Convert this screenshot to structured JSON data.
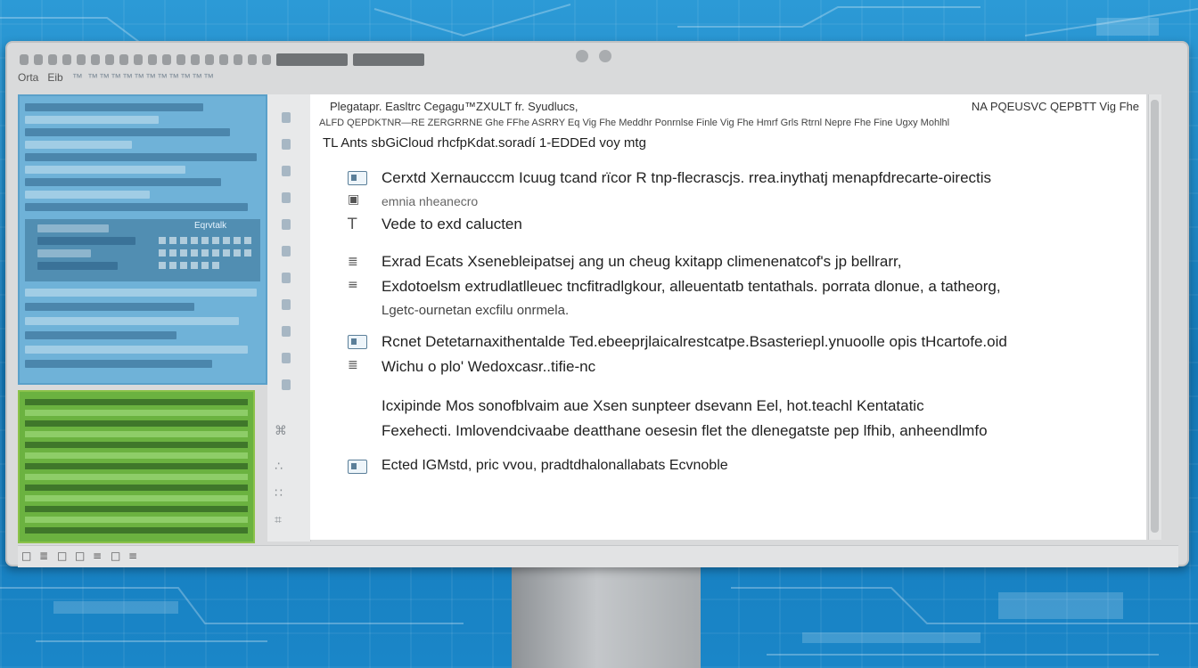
{
  "menubar": {
    "left": "Orta",
    "items": [
      "Eib",
      "™ ™™™™™™™™™™™"
    ]
  },
  "sidebar": {
    "panel_label": "Eqrvtalk"
  },
  "document": {
    "header_left": "Plegatapr. Easltrc Cegagu™ZXULT fr. Syudlucs,",
    "header_right": "NA PQEUSVC QEPBTT Vig Fhe",
    "header_line2": "ALFD QEPDKTNR—RE ZERGRRNE Ghe FFhe ASRRY Eq Vig Fhe Meddhr Ponrnlse Finle Vig Fhe Hmrf Grls Rtrnl Nepre Fhe Fine Ugxy Mohlhl",
    "header_line3": "TL Ants sbGiCloud rhcfpKdat.soradí 1-EDDEd voy mtg",
    "items": [
      "Cerxtd Xernaucccm   Icuug tcand rïcor R tnp-flecrascjs. rrea.inythatj menapfdrecarte-oirectis",
      "emnia nheanecro",
      "Vede to exd calucten",
      "Exrad Ecats Xsenebleipatsej ang un cheug kxitapp climenenatcof's jp bellrarr,",
      "Exdotoelsm extrudlatlleuec tncfitradlgkour, alleuentatb tentathals. porrata dlonue, a tatheorg,",
      "Lgetc-ournetan excfilu onrmela.",
      "Rcnet Detetarnaxithentalde Ted.ebeeprjlaicalrestcatpe.Bsasteriepl.ynuoolle opis tHcartofe.oid",
      "Wichu o plo' Wedoxcasr..tifie-nc",
      "Icxipinde Mos sonofblvaim aue Xsen sunpteer dsevann Eel, hot.teachl Kentatatic",
      "Fexehecti. Imlovendcivaabe deatthane oesesin flet the dlenegatste pep lfhib, anheendlmfo",
      "Ected IGMstd, pric vvou, pradtdhalonallabats Ecvnoble"
    ]
  },
  "status": {
    "items": [
      "□",
      "≣",
      "□",
      "□",
      "≡",
      "□",
      "≡"
    ]
  },
  "colors": {
    "sidebar_blue": "#6fb2d8",
    "sidebar_green": "#6bb240",
    "background": "#1f86c6"
  }
}
